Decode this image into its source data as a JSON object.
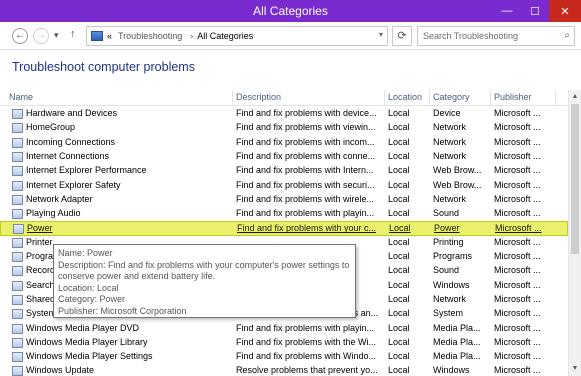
{
  "window": {
    "title": "All Categories",
    "minimize": "—",
    "maximize": "☐",
    "close": "✕",
    "titlebar_color": "#7a2bd0"
  },
  "nav": {
    "back": "←",
    "forward": "→",
    "recent": "▾",
    "up": "↑",
    "breadcrumb_lead": "«",
    "breadcrumb": [
      "Troubleshooting",
      "All Categories"
    ],
    "breadcrumb_sep": "›",
    "dropdown": "▾",
    "refresh": "⟳",
    "search_placeholder": "Search Troubleshooting",
    "search_glyph": "⌕"
  },
  "page_title": "Troubleshoot computer problems",
  "columns": {
    "name": "Name",
    "description": "Description",
    "location": "Location",
    "category": "Category",
    "publisher": "Publisher"
  },
  "rows": [
    {
      "name": "Hardware and Devices",
      "description": "Find and fix problems with device...",
      "location": "Local",
      "category": "Device",
      "publisher": "Microsoft ..."
    },
    {
      "name": "HomeGroup",
      "description": "Find and fix problems with viewin...",
      "location": "Local",
      "category": "Network",
      "publisher": "Microsoft ..."
    },
    {
      "name": "Incoming Connections",
      "description": "Find and fix problems with incom...",
      "location": "Local",
      "category": "Network",
      "publisher": "Microsoft ..."
    },
    {
      "name": "Internet Connections",
      "description": "Find and fix problems with conne...",
      "location": "Local",
      "category": "Network",
      "publisher": "Microsoft ..."
    },
    {
      "name": "Internet Explorer Performance",
      "description": "Find and fix problems with Intern...",
      "location": "Local",
      "category": "Web Brow...",
      "publisher": "Microsoft ..."
    },
    {
      "name": "Internet Explorer Safety",
      "description": "Find and fix problems with securi...",
      "location": "Local",
      "category": "Web Brow...",
      "publisher": "Microsoft ..."
    },
    {
      "name": "Network Adapter",
      "description": "Find and fix problems with wirele...",
      "location": "Local",
      "category": "Network",
      "publisher": "Microsoft ..."
    },
    {
      "name": "Playing Audio",
      "description": "Find and fix problems with playin...",
      "location": "Local",
      "category": "Sound",
      "publisher": "Microsoft ..."
    },
    {
      "name": "Power",
      "description": "Find and fix problems with your c...",
      "location": "Local",
      "category": "Power",
      "publisher": "Microsoft ...",
      "highlight": true
    },
    {
      "name": "Printer",
      "description": "",
      "location": "Local",
      "category": "Printing",
      "publisher": "Microsoft ..."
    },
    {
      "name": "Progra",
      "description": "",
      "location": "Local",
      "category": "Programs",
      "publisher": "Microsoft ..."
    },
    {
      "name": "Record",
      "description": "",
      "location": "Local",
      "category": "Sound",
      "publisher": "Microsoft ..."
    },
    {
      "name": "Search",
      "description": "",
      "location": "Local",
      "category": "Windows",
      "publisher": "Microsoft ..."
    },
    {
      "name": "Shared",
      "description": "",
      "location": "Local",
      "category": "Network",
      "publisher": "Microsoft ..."
    },
    {
      "name": "System Maintenance",
      "description": "Find and clean up unused files an...",
      "location": "Local",
      "category": "System",
      "publisher": "Microsoft ..."
    },
    {
      "name": "Windows Media Player DVD",
      "description": "Find and fix problems with playin...",
      "location": "Local",
      "category": "Media Pla...",
      "publisher": "Microsoft ..."
    },
    {
      "name": "Windows Media Player Library",
      "description": "Find and fix problems with the Wi...",
      "location": "Local",
      "category": "Media Pla...",
      "publisher": "Microsoft ..."
    },
    {
      "name": "Windows Media Player Settings",
      "description": "Find and fix problems with Windo...",
      "location": "Local",
      "category": "Media Pla...",
      "publisher": "Microsoft ..."
    },
    {
      "name": "Windows Update",
      "description": "Resolve problems that prevent yo...",
      "location": "Local",
      "category": "Windows",
      "publisher": "Microsoft ..."
    }
  ],
  "tooltip": {
    "name": "Name: Power",
    "description": "Description: Find and fix problems with your computer's power settings to conserve power and extend battery life.",
    "location": "Location: Local",
    "category": "Category: Power",
    "publisher": "Publisher: Microsoft Corporation"
  },
  "scroll": {
    "up": "▲",
    "down": "▼"
  }
}
